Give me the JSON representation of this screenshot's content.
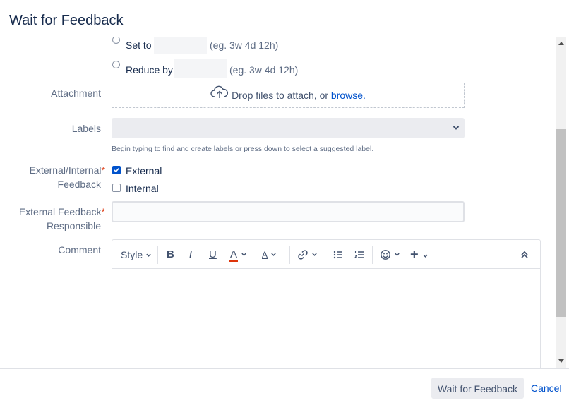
{
  "dialog": {
    "title": "Wait for Feedback"
  },
  "time_tracking": {
    "set_to_label": "Set to",
    "set_to_hint": "(eg. 3w 4d 12h)",
    "reduce_by_label": "Reduce by",
    "reduce_by_hint": "(eg. 3w 4d 12h)"
  },
  "attachment": {
    "label": "Attachment",
    "text": "Drop files to attach, or",
    "link": "browse."
  },
  "labels": {
    "label": "Labels",
    "help": "Begin typing to find and create labels or press down to select a suggested label."
  },
  "feedback_type": {
    "label_line1": "External/Internal",
    "label_line2": "Feedback",
    "required": "*",
    "options": [
      {
        "label": "External",
        "checked": true
      },
      {
        "label": "Internal",
        "checked": false
      }
    ]
  },
  "feedback_responsible": {
    "label_line1": "External Feedback",
    "label_line2": "Responsible",
    "required": "*",
    "value": ""
  },
  "comment": {
    "label": "Comment",
    "toolbar": {
      "style": "Style",
      "bold": "B",
      "italic": "I",
      "underline": "U",
      "text_color": "A",
      "more_formatting": "A",
      "link_icon": "link-icon",
      "bullet_icon": "bullet-list-icon",
      "numbered_icon": "numbered-list-icon",
      "emoji_icon": "emoji-icon",
      "insert": "+",
      "collapse_icon": "collapse-icon"
    }
  },
  "footer": {
    "submit": "Wait for Feedback",
    "cancel": "Cancel"
  },
  "colors": {
    "link": "#0052cc",
    "required": "#de350b",
    "checkbox": "#0052cc",
    "text_color_underline": "#de350b"
  }
}
